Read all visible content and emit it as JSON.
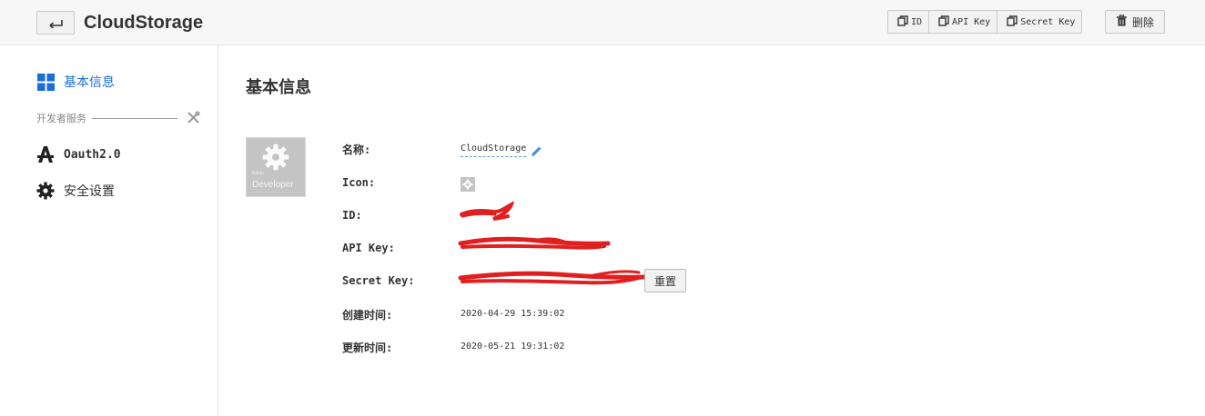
{
  "header": {
    "title": "CloudStorage",
    "copy_buttons": [
      "ID",
      "API Key",
      "Secret Key"
    ],
    "delete_label": "删除"
  },
  "sidebar": {
    "basic_info": "基本信息",
    "section_label": "开发者服务",
    "oauth": "Oauth2.0",
    "security": "安全设置"
  },
  "main": {
    "title": "基本信息",
    "logo_small": "Baidu",
    "logo_text": "Developer",
    "fields": {
      "name_label": "名称:",
      "name_value": "CloudStorage",
      "icon_label": "Icon:",
      "id_label": "ID:",
      "apikey_label": "API Key:",
      "secret_label": "Secret Key:",
      "reset_label": "重置",
      "created_label": "创建时间:",
      "created_value": "2020-04-29 15:39:02",
      "updated_label": "更新时间:",
      "updated_value": "2020-05-21 19:31:02"
    }
  },
  "colors": {
    "accent": "#1a6ed8",
    "redaction": "#e02020",
    "logo_bg": "#c4c4c4"
  }
}
